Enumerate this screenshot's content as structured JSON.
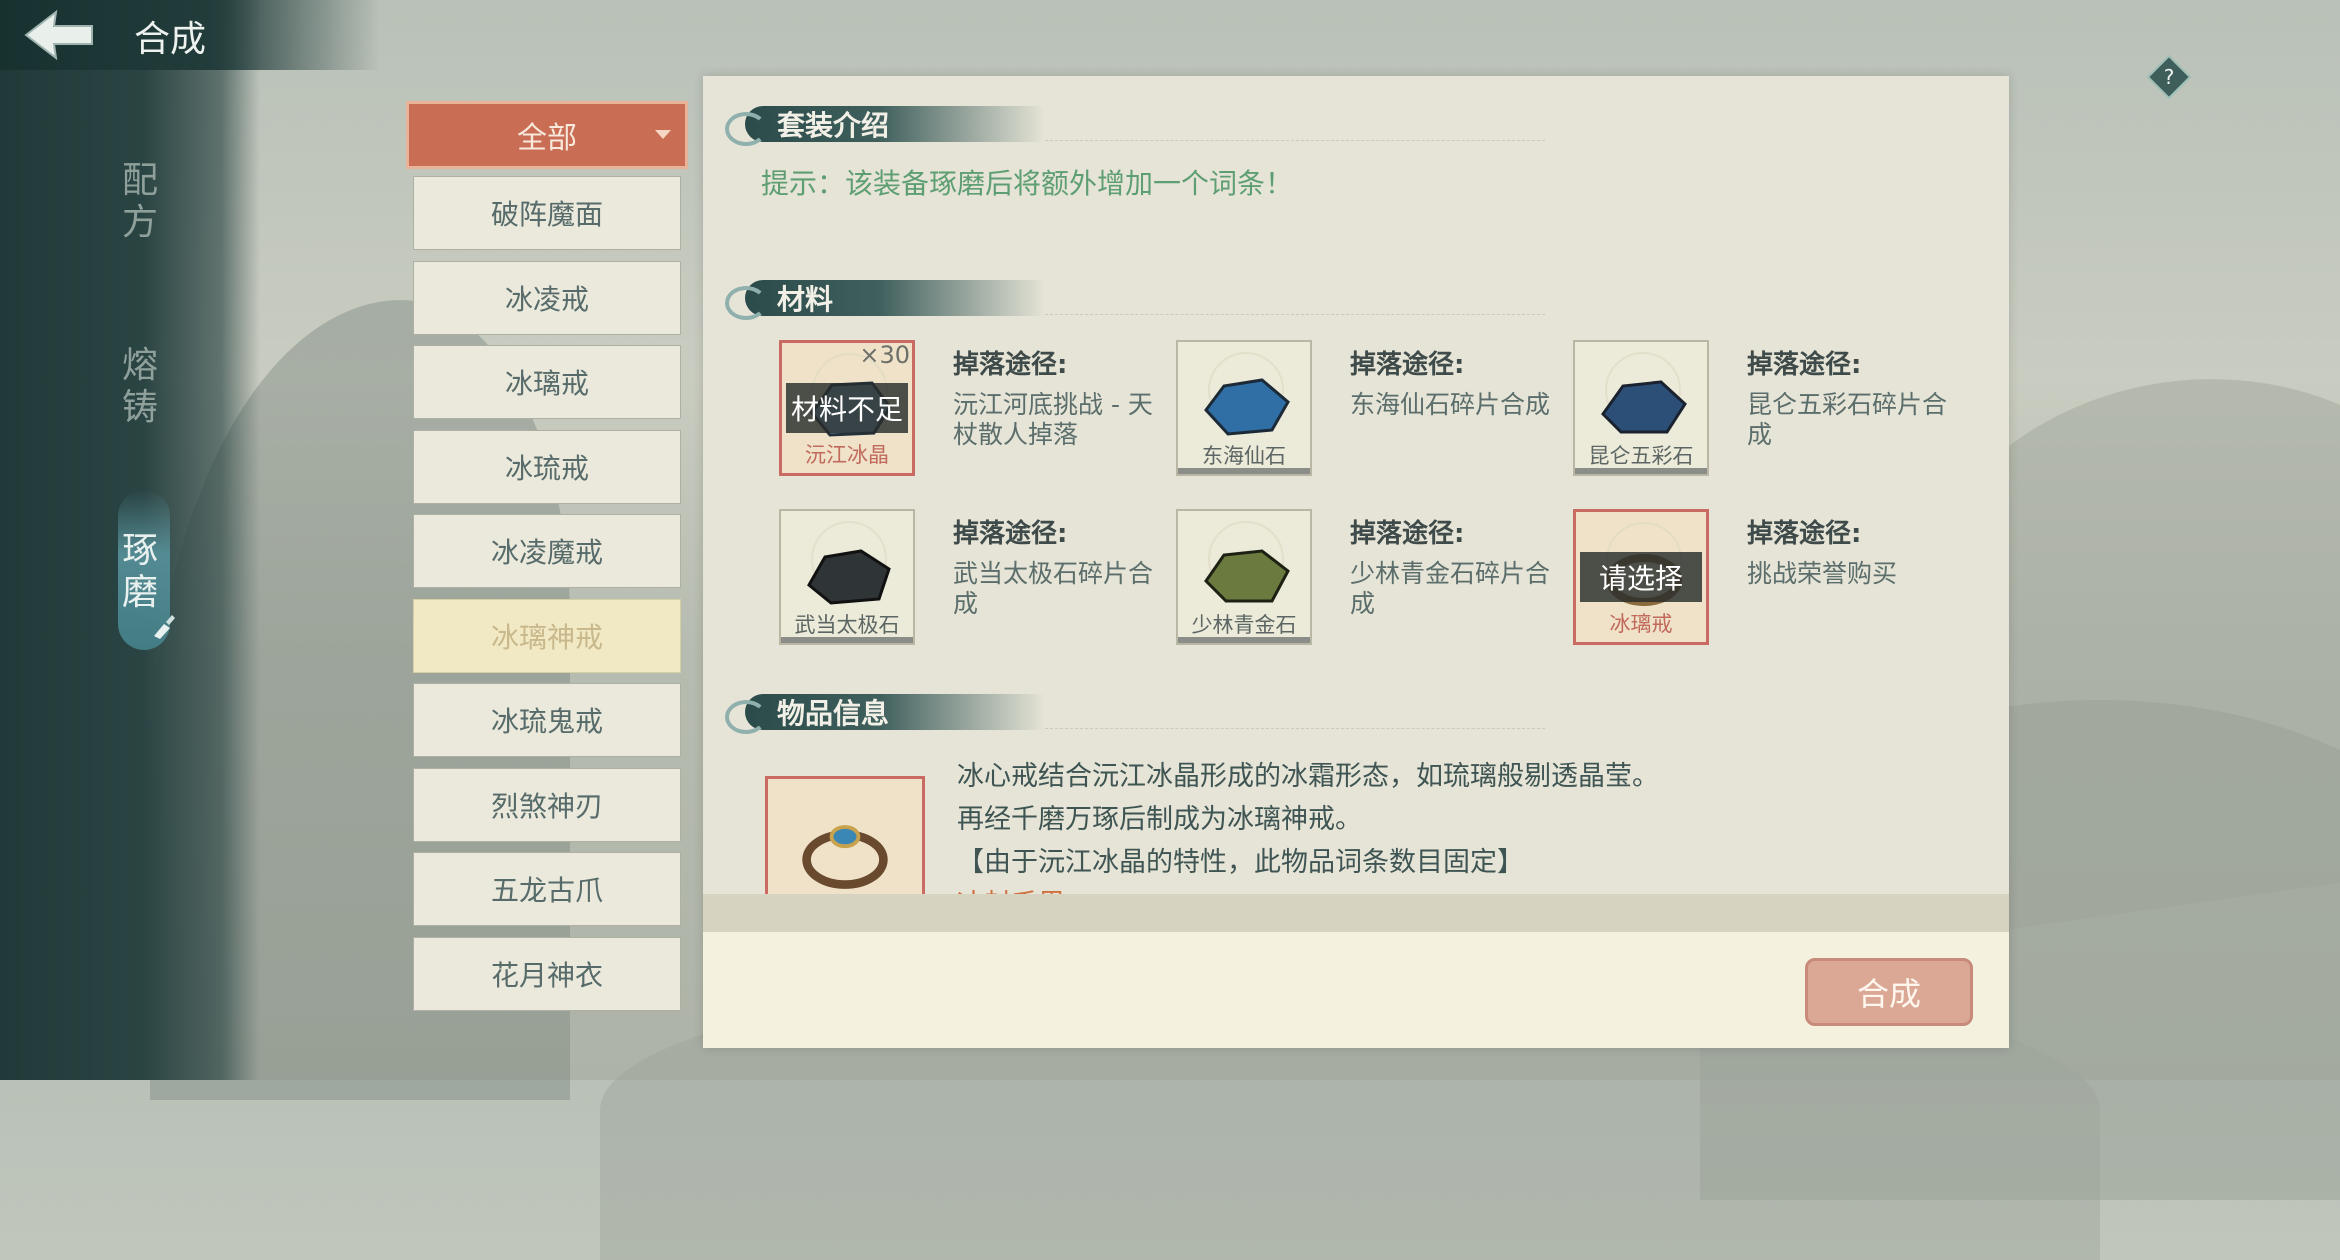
{
  "header": {
    "title": "合成"
  },
  "rail": {
    "items": [
      "配方",
      "熔铸",
      "琢磨"
    ]
  },
  "filter": {
    "label": "全部"
  },
  "list": {
    "items": [
      "破阵魔面",
      "冰凌戒",
      "冰璃戒",
      "冰琉戒",
      "冰凌魔戒",
      "冰璃神戒",
      "冰琉鬼戒",
      "烈煞神刃",
      "五龙古爪",
      "花月神衣"
    ],
    "selected_index": 5
  },
  "set_intro": {
    "heading": "套装介绍",
    "hint": "提示：该装备琢磨后将额外增加一个词条！"
  },
  "materials": {
    "heading": "材料",
    "source_title": "掉落途径:",
    "items": [
      {
        "name": "沅江冰晶",
        "count": "×30",
        "overlay": "材料不足",
        "source": "沅江河底挑战 - 天杖散人掉落",
        "gem_color": "#7ea5c0"
      },
      {
        "name": "东海仙石",
        "count": "",
        "overlay": "",
        "source": "东海仙石碎片合成",
        "gem_color": "#2f6fa6"
      },
      {
        "name": "昆仑五彩石",
        "count": "",
        "overlay": "",
        "source": "昆仑五彩石碎片合成",
        "gem_color": "#2c4f78"
      },
      {
        "name": "武当太极石",
        "count": "",
        "overlay": "",
        "source": "武当太极石碎片合成",
        "gem_color": "#2f3436"
      },
      {
        "name": "少林青金石",
        "count": "",
        "overlay": "",
        "source": "少林青金石碎片合成",
        "gem_color": "#6b7a3e"
      },
      {
        "name": "冰璃戒",
        "count": "",
        "overlay": "请选择",
        "source": "挑战荣誉购买",
        "gem_color": "#8a6a3a"
      }
    ]
  },
  "item_info": {
    "heading": "物品信息",
    "lines": [
      "冰心戒结合沅江冰晶形成的冰霜形态，如琉璃般剔透晶莹。",
      "再经千磨万琢后制成为冰璃神戒。",
      "【由于沅江冰晶的特性，此物品词条数目固定】",
      "冰封千里"
    ]
  },
  "actions": {
    "synth_label": "合成"
  }
}
